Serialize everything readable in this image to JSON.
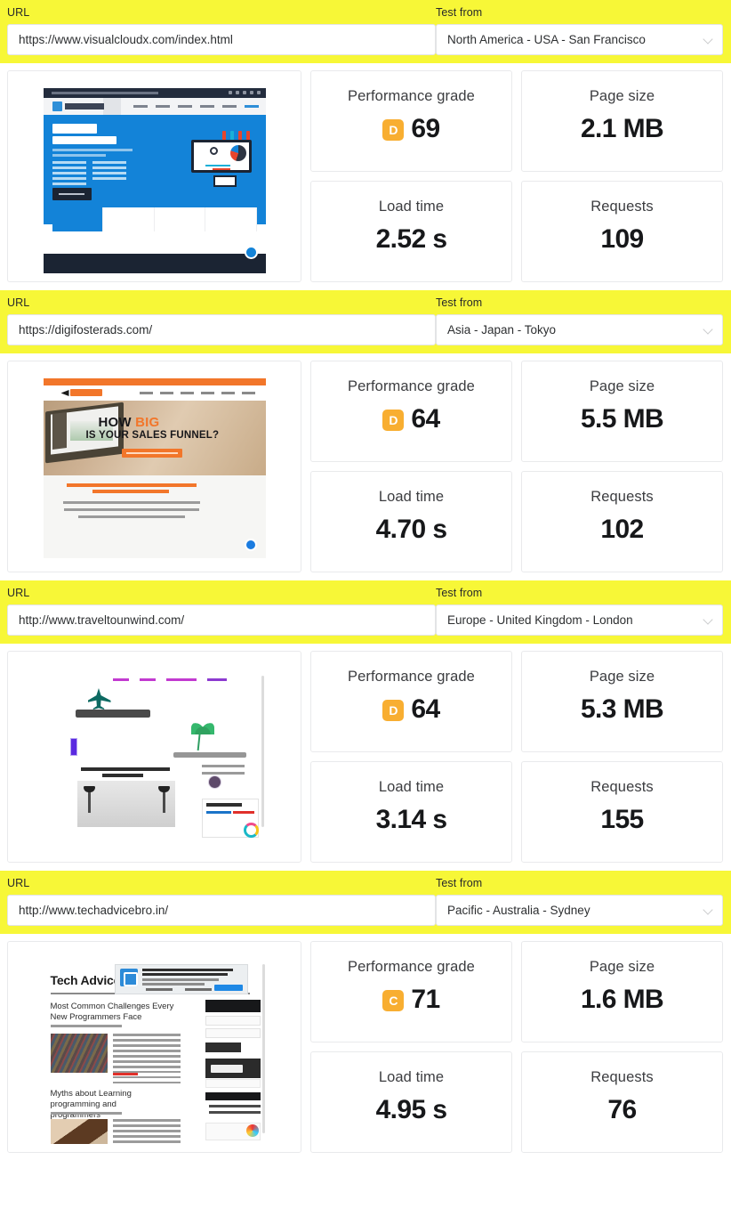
{
  "labels": {
    "url": "URL",
    "test_from": "Test from",
    "performance_grade": "Performance grade",
    "page_size": "Page size",
    "load_time": "Load time",
    "requests": "Requests"
  },
  "colors": {
    "band_yellow": "#f7f737",
    "grade_badge_orange": "#f8ae31",
    "card_border": "#e9eaec",
    "value_text": "#17181a"
  },
  "icons": {
    "dropdown": "chevron-down-icon"
  },
  "results": [
    {
      "url": "https://www.visualcloudx.com/index.html",
      "location": "North America - USA - San Francisco",
      "grade_letter": "D",
      "grade_score": "69",
      "page_size": "2.1 MB",
      "load_time": "2.52 s",
      "requests": "109",
      "thumbnail_alt": "VisualCloudX shared hosting services homepage"
    },
    {
      "url": "https://digifosterads.com/",
      "location": "Asia - Japan - Tokyo",
      "grade_letter": "D",
      "grade_score": "64",
      "page_size": "5.5 MB",
      "load_time": "4.70 s",
      "requests": "102",
      "thumbnail_alt": "Digifoster Ads sales funnel homepage"
    },
    {
      "url": "http://www.traveltounwind.com/",
      "location": "Europe - United Kingdom - London",
      "grade_letter": "D",
      "grade_score": "64",
      "page_size": "5.3 MB",
      "load_time": "3.14 s",
      "requests": "155",
      "thumbnail_alt": "Travel To Unwind travel blog homepage"
    },
    {
      "url": "http://www.techadvicebro.in/",
      "location": "Pacific - Australia - Sydney",
      "grade_letter": "C",
      "grade_score": "71",
      "page_size": "1.6 MB",
      "load_time": "4.95 s",
      "requests": "76",
      "thumbnail_alt": "Tech Advice Bro programming blog homepage"
    }
  ]
}
